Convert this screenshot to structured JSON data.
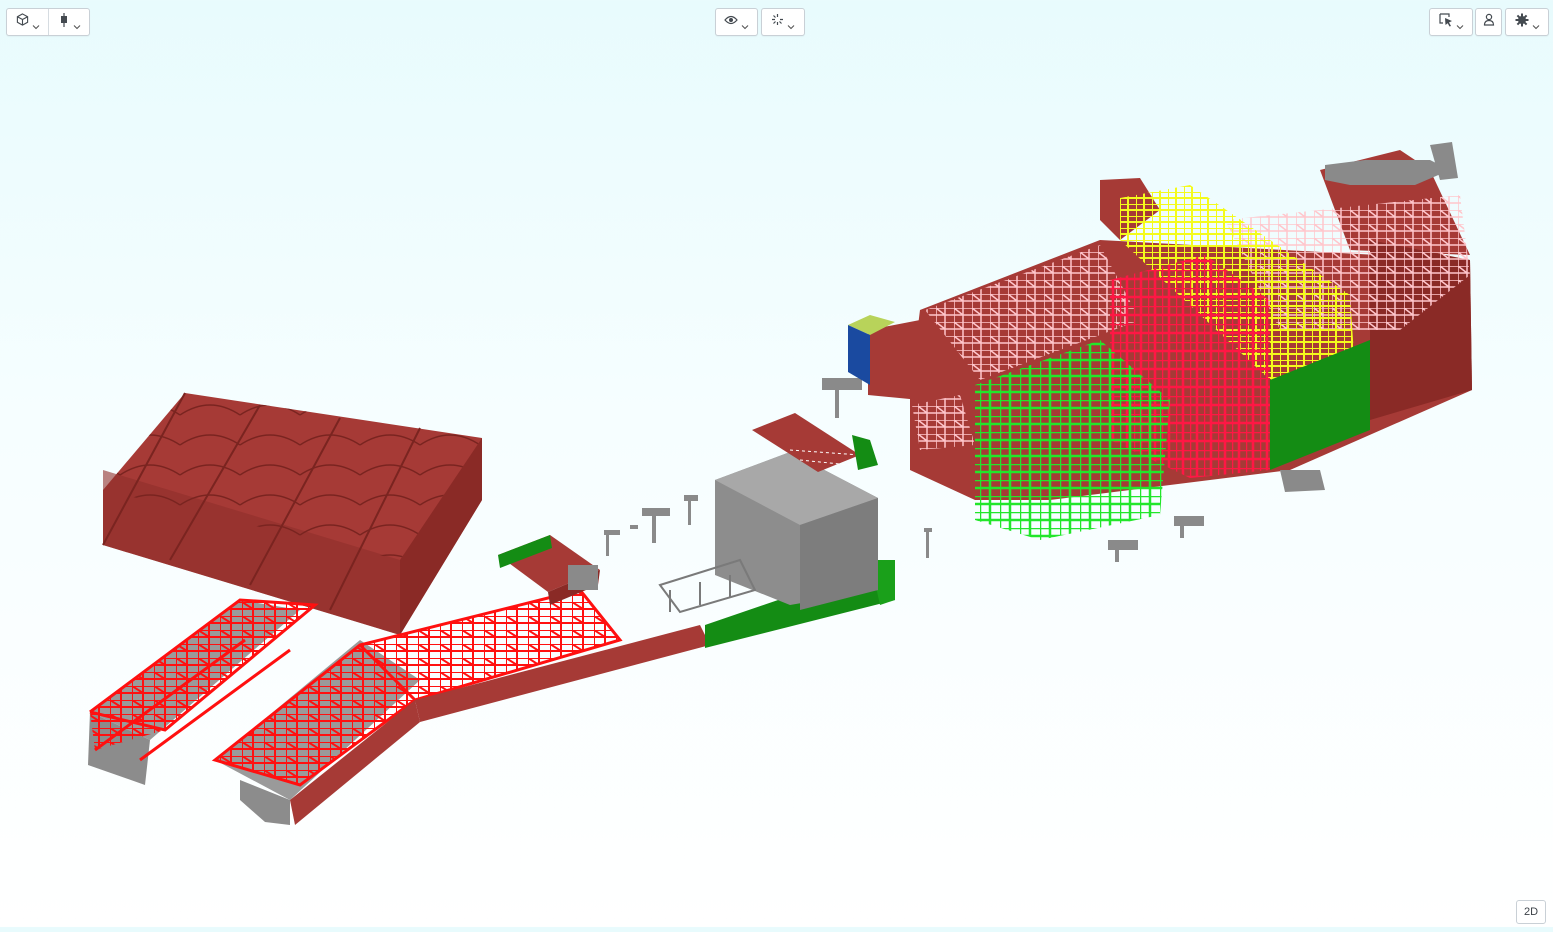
{
  "toolbar": {
    "left": [
      {
        "icon": "cube-view-icon",
        "has_dropdown": true
      },
      {
        "icon": "section-plane-icon",
        "has_dropdown": true
      }
    ],
    "center": [
      {
        "icon": "eye-visibility-icon",
        "has_dropdown": true
      },
      {
        "icon": "explode-icon",
        "has_dropdown": true
      }
    ],
    "right": [
      {
        "icon": "select-cursor-icon",
        "has_dropdown": true
      },
      {
        "icon": "person-view-icon",
        "has_dropdown": false
      },
      {
        "icon": "settings-gear-icon",
        "has_dropdown": true
      }
    ]
  },
  "view_mode_button": {
    "label": "2D"
  },
  "model_colors": {
    "walls": "#a63a36",
    "steel_red": "#ff1a1a",
    "steel_green": "#22e62a",
    "steel_yellow": "#f4fb1c",
    "steel_pink": "#ffb6c1",
    "roof_green": "#148c14",
    "concrete": "#8a8a8a",
    "panel_blue": "#1a4aa0"
  }
}
